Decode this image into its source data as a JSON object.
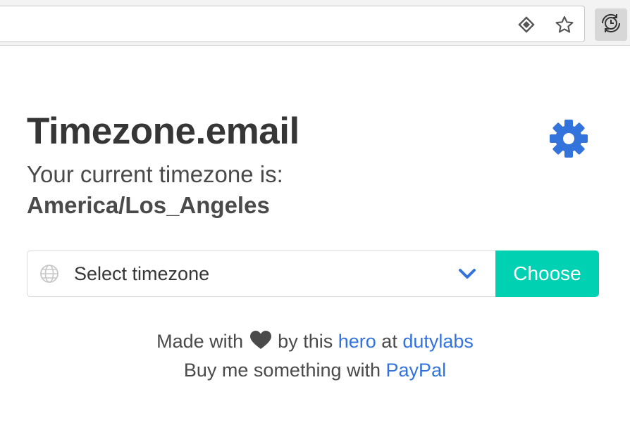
{
  "popup": {
    "title": "Timezone.email",
    "subtitle": "Your current timezone is:",
    "current_timezone": "America/Los_Angeles",
    "select": {
      "selected_label": "Select timezone",
      "globe_icon": "globe-icon",
      "chevron_icon": "chevron-down-icon"
    },
    "choose_label": "Choose",
    "settings_icon": "gear-icon",
    "footer": {
      "made_with": "Made with",
      "heart_icon": "heart-icon",
      "by_this": "by this",
      "hero_link": "hero",
      "at": "at",
      "dutylabs_link": "dutylabs",
      "buy_me": "Buy me something with",
      "paypal_link": "PayPal"
    }
  },
  "browser": {
    "url_icons": [
      "reader-icon",
      "star-icon"
    ],
    "extension_icon": "clock-sync-icon"
  },
  "colors": {
    "accent_blue": "#3273dc",
    "choose_button": "#00d1b2",
    "title_text": "#363636"
  }
}
